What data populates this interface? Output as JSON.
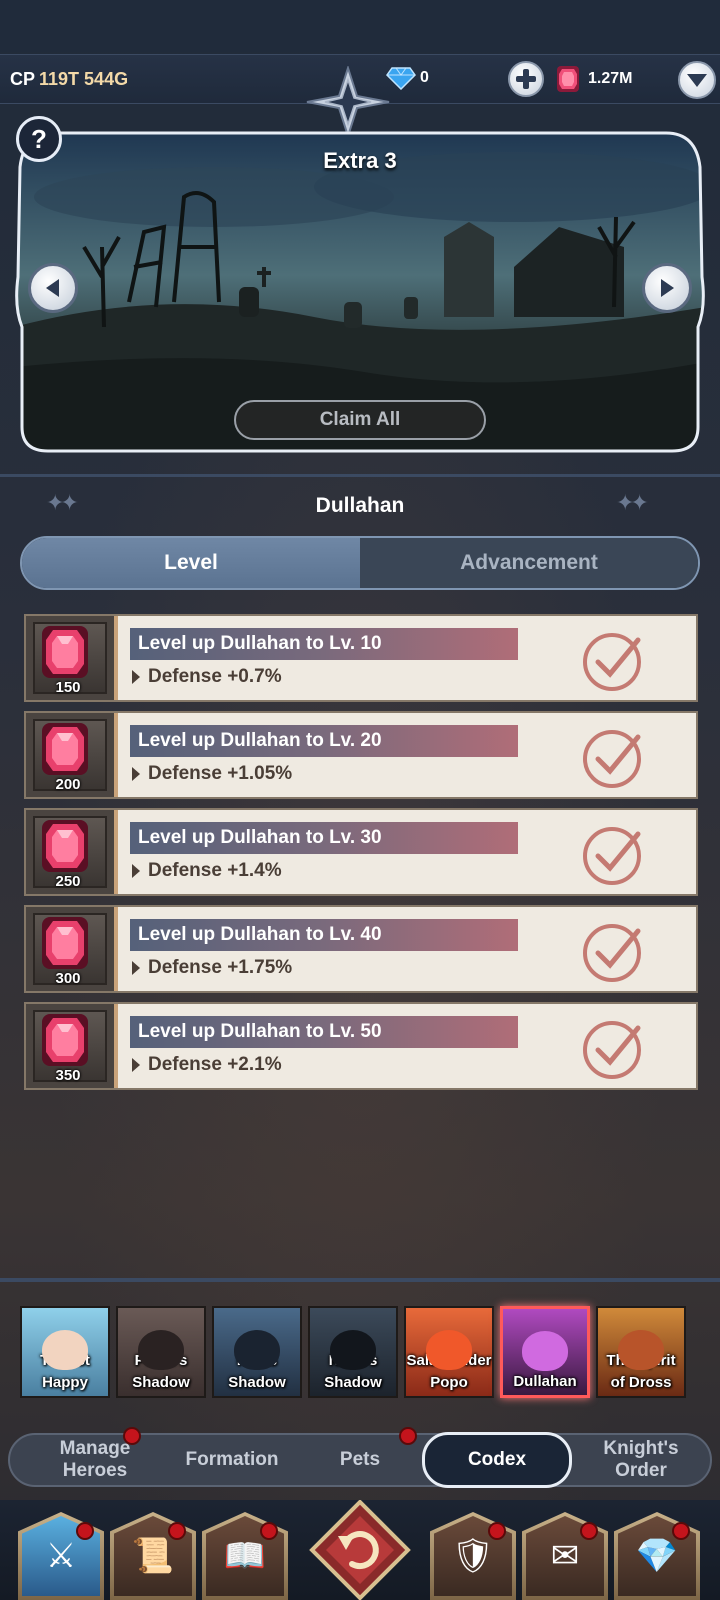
{
  "header": {
    "cp_label": "CP",
    "cp_value": "119T 544G",
    "diamonds": "0",
    "gems": "1.27M"
  },
  "banner": {
    "stage_title": "Extra 3",
    "help_label": "?",
    "claim_all_label": "Claim All"
  },
  "codex": {
    "hero_name": "Dullahan",
    "tabs": [
      {
        "label": "Level",
        "active": true
      },
      {
        "label": "Advancement",
        "active": false
      }
    ],
    "quests": [
      {
        "reward": "150",
        "title": "Level up Dullahan to Lv. 10",
        "desc": "Defense +0.7%",
        "done": true
      },
      {
        "reward": "200",
        "title": "Level up Dullahan to Lv. 20",
        "desc": "Defense +1.05%",
        "done": true
      },
      {
        "reward": "250",
        "title": "Level up Dullahan to Lv. 30",
        "desc": "Defense +1.4%",
        "done": true
      },
      {
        "reward": "300",
        "title": "Level up Dullahan to Lv. 40",
        "desc": "Defense +1.75%",
        "done": true
      },
      {
        "reward": "350",
        "title": "Level up Dullahan to Lv. 50",
        "desc": "Defense +2.1%",
        "done": true
      }
    ]
  },
  "roster": [
    {
      "label": "Tourist Happy",
      "color": "#6fb6d8",
      "selected": false
    },
    {
      "label": "Pooki's Shadow",
      "color": "#5a4a4a",
      "selected": false
    },
    {
      "label": "Pon's Shadow",
      "color": "#3a4f6a",
      "selected": false
    },
    {
      "label": "Nami's Shadow",
      "color": "#2f3a48",
      "selected": false
    },
    {
      "label": "Salamander Popo",
      "color": "#d9552f",
      "selected": false
    },
    {
      "label": "Dullahan",
      "color": "#8a3f8e",
      "selected": true
    },
    {
      "label": "The Spirit of Dross",
      "color": "#a8552a",
      "selected": false
    }
  ],
  "subnav": {
    "items": [
      {
        "label": "Manage Heroes",
        "badge": true,
        "active": false
      },
      {
        "label": "Formation",
        "badge": false,
        "active": false
      },
      {
        "label": "Pets",
        "badge": true,
        "active": false
      },
      {
        "label": "Codex",
        "badge": false,
        "active": true
      },
      {
        "label": "Knight's Order",
        "badge": false,
        "active": false
      }
    ]
  },
  "bottom_nav": {
    "items": [
      {
        "icon": "hero-helmet-icon",
        "badge": true
      },
      {
        "icon": "treasure-scroll-icon",
        "badge": true
      },
      {
        "icon": "spellbook-icon",
        "badge": true
      },
      {
        "icon": "return-icon",
        "badge": false
      },
      {
        "icon": "guild-shield-icon",
        "badge": true
      },
      {
        "icon": "letter-scroll-icon",
        "badge": true
      },
      {
        "icon": "treasure-chest-icon",
        "badge": true
      }
    ]
  },
  "colors": {
    "accent_red": "#c4141c",
    "quest_title_start": "#55617a",
    "quest_title_end": "#b06d78",
    "check_color": "#c47a72"
  }
}
